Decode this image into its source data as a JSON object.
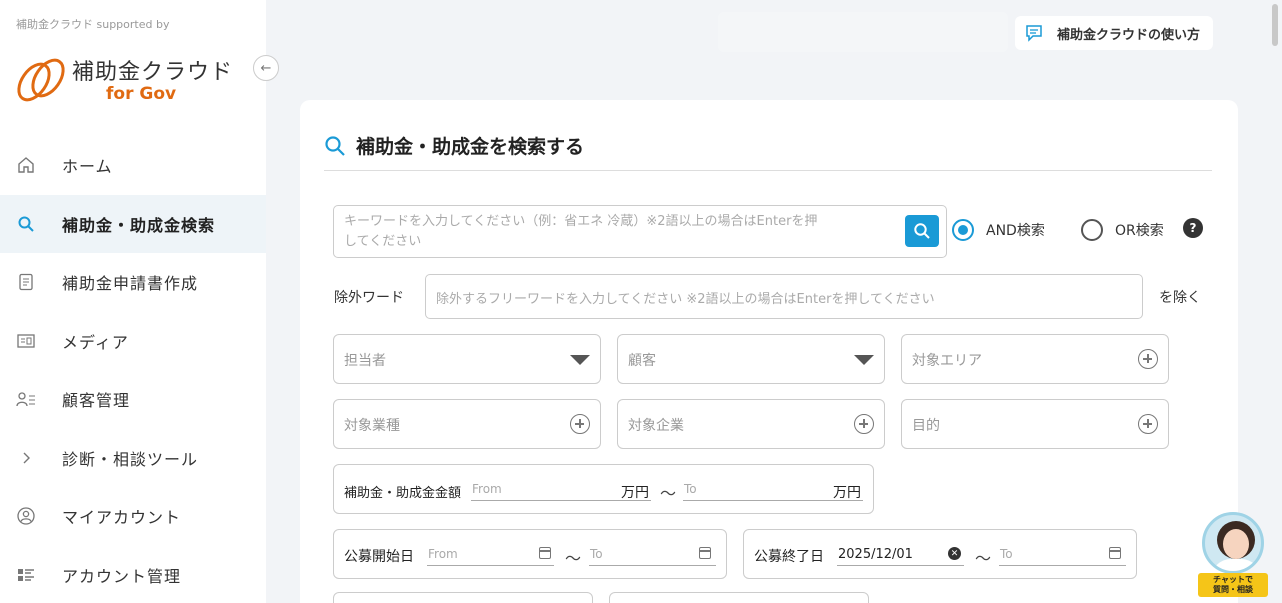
{
  "sidebar": {
    "supported_by": "補助金クラウド supported by",
    "logo_name": "補助金クラウド",
    "logo_sub": "for Gov",
    "collapse_icon": "←",
    "items": [
      {
        "label": "ホーム",
        "icon": "home-icon"
      },
      {
        "label": "補助金・助成金検索",
        "icon": "search-icon",
        "active": true
      },
      {
        "label": "補助金申請書作成",
        "icon": "document-icon"
      },
      {
        "label": "メディア",
        "icon": "media-icon"
      },
      {
        "label": "顧客管理",
        "icon": "customer-icon"
      },
      {
        "label": "診断・相談ツール",
        "icon": "chevron-right-icon"
      },
      {
        "label": "マイアカウント",
        "icon": "user-circle-icon"
      },
      {
        "label": "アカウント管理",
        "icon": "account-grid-icon"
      }
    ]
  },
  "header": {
    "help_label": "補助金クラウドの使い方"
  },
  "search": {
    "title": "補助金・助成金を検索する",
    "keyword_placeholder_line1": "キーワードを入力してください（例：省エネ 冷蔵）※2語以上の場合はEnterを押",
    "keyword_placeholder_line2": "してください",
    "and_label": "AND検索",
    "or_label": "OR検索",
    "mode": "AND",
    "help_mark": "?",
    "exclude_label": "除外ワード",
    "exclude_placeholder": "除外するフリーワードを入力してください ※2語以上の場合はEnterを押してください",
    "exclude_suffix": "を除く",
    "fields": {
      "staff": "担当者",
      "customer": "顧客",
      "area": "対象エリア",
      "industry": "対象業種",
      "company": "対象企業",
      "purpose": "目的"
    },
    "amount": {
      "label": "補助金・助成金金額",
      "from": "From",
      "to": "To",
      "unit": "万円",
      "tilde": "〜"
    },
    "start_date": {
      "label": "公募開始日",
      "from": "From",
      "to": "To",
      "tilde": "〜"
    },
    "end_date": {
      "label": "公募終了日",
      "from_value": "2025/12/01",
      "to": "To",
      "tilde": "〜"
    }
  },
  "chat": {
    "label_line1": "チャットで",
    "label_line2": "質問・相談"
  },
  "colors": {
    "accent": "#1a9ad6",
    "brand_orange": "#e06a12",
    "chat_label": "#f5c518"
  }
}
